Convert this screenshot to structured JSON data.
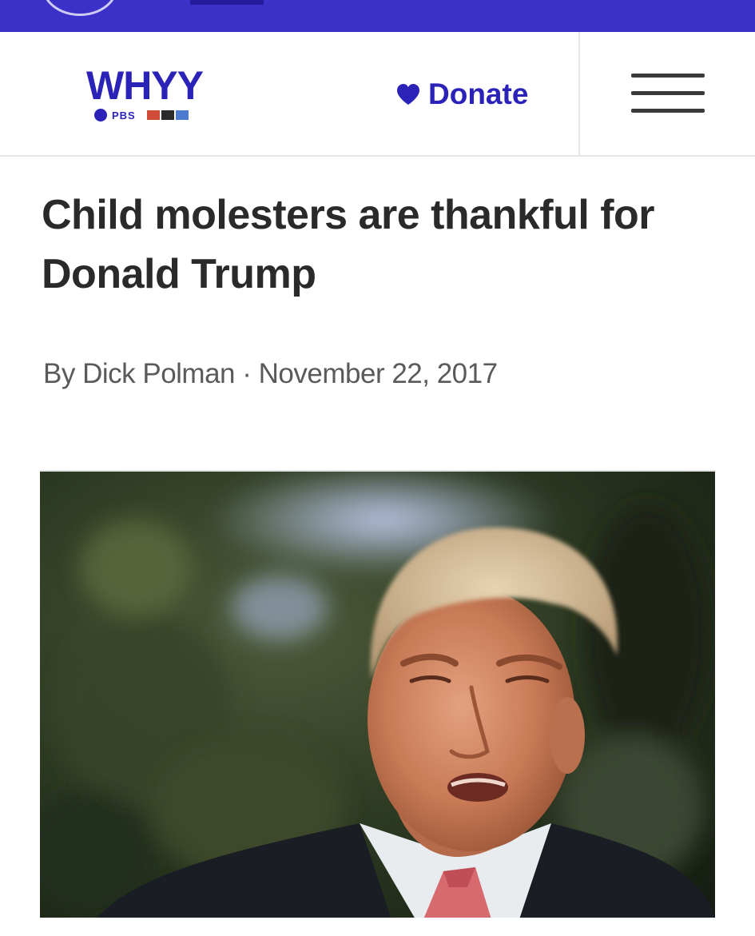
{
  "site": {
    "logo_text": "WHYY",
    "partner_text": "PBS",
    "brand_color": "#2b23b8",
    "strip_color": "#3b30c7"
  },
  "header": {
    "donate_label": "Donate",
    "donate_icon": "heart-icon",
    "menu_icon": "hamburger-menu-icon"
  },
  "article": {
    "headline": "Child molesters are thankful for Donald Trump",
    "author": "By Dick Polman",
    "separator": "·",
    "date": "November 22, 2017",
    "image_alt": "Photo of Donald Trump speaking outdoors"
  }
}
